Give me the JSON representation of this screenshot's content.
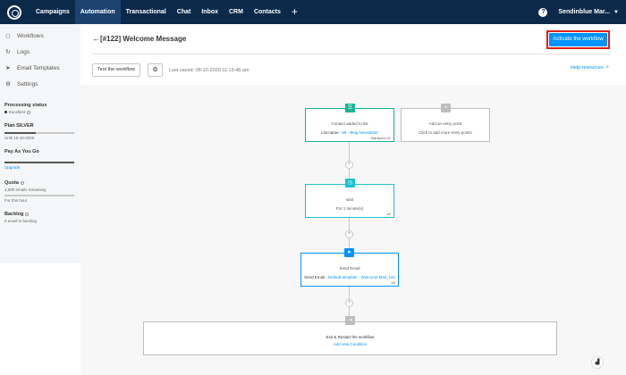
{
  "nav": {
    "items": [
      "Campaigns",
      "Automation",
      "Transactional",
      "Chat",
      "Inbox",
      "CRM",
      "Contacts"
    ],
    "plus": "+",
    "account": "Sendinblue Mar...",
    "help": "?"
  },
  "sidebar": {
    "links": [
      {
        "icon": "◻",
        "label": "Workflows"
      },
      {
        "icon": "↻",
        "label": "Logs"
      },
      {
        "icon": "➤",
        "label": "Email Templates"
      },
      {
        "icon": "⚙",
        "label": "Settings"
      }
    ],
    "processing_title": "Processing status",
    "processing_value": "Excellent",
    "plan_title": "Plan SILVER",
    "plan_bar": 0.45,
    "plan_until": "Until 15-10-2020",
    "payg_title": "Pay As You Go",
    "payg_bar": 1.0,
    "upgrade": "Upgrade",
    "quota_title": "Quota",
    "quota_value": "1,000 emails remaining",
    "quota_sub": "For this hour",
    "backlog_title": "Backlog",
    "backlog_value": "0 email in backlog"
  },
  "header": {
    "back": "←",
    "title": "[#122] Welcome Message",
    "activate": "Activate the workflow",
    "test": "Test the workflow",
    "settings_icon": "⚙",
    "last_saved": "Last saved: 08-10-2020 11:15:48 am",
    "help_resources": "Help resources"
  },
  "workflow": {
    "entry1": {
      "title": "Contact added to list",
      "label": "List name :",
      "value": "69 - Blog Newsletter",
      "num": "Startpoint #1"
    },
    "entry2": {
      "title": "Add an entry point",
      "sub": "Click to add more entry points"
    },
    "wait": {
      "title": "wait",
      "sub": "For 1 minute(s)",
      "num": "#2"
    },
    "send": {
      "title": "Send Email",
      "label": "Send Email :",
      "value": "Default template - Welcome Mail_122",
      "num": "#3"
    },
    "exit": {
      "title": "Exit & Restart the workflow",
      "link": "Add new Condition"
    },
    "plus": "+",
    "colors": {
      "teal": "#12b495",
      "cyan": "#1bc0d2",
      "blue": "#0092ff",
      "grey": "#bdbdbd"
    }
  },
  "chat_icon": "▟"
}
